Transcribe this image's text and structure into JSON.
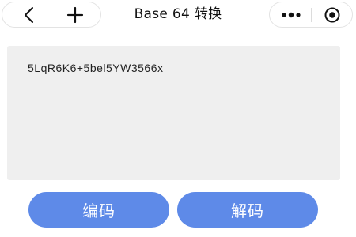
{
  "navbar": {
    "title": "Base 64 转换",
    "left_icons": [
      "back-icon",
      "add-icon"
    ],
    "right_icons": [
      "more-icon",
      "target-icon"
    ]
  },
  "content": {
    "text_value": "5LqR6K6+5bel5YW3566x"
  },
  "actions": {
    "encode_label": "编码",
    "decode_label": "解码"
  },
  "colors": {
    "button": "#5e8ae8",
    "text_box_bg": "#efefef"
  }
}
